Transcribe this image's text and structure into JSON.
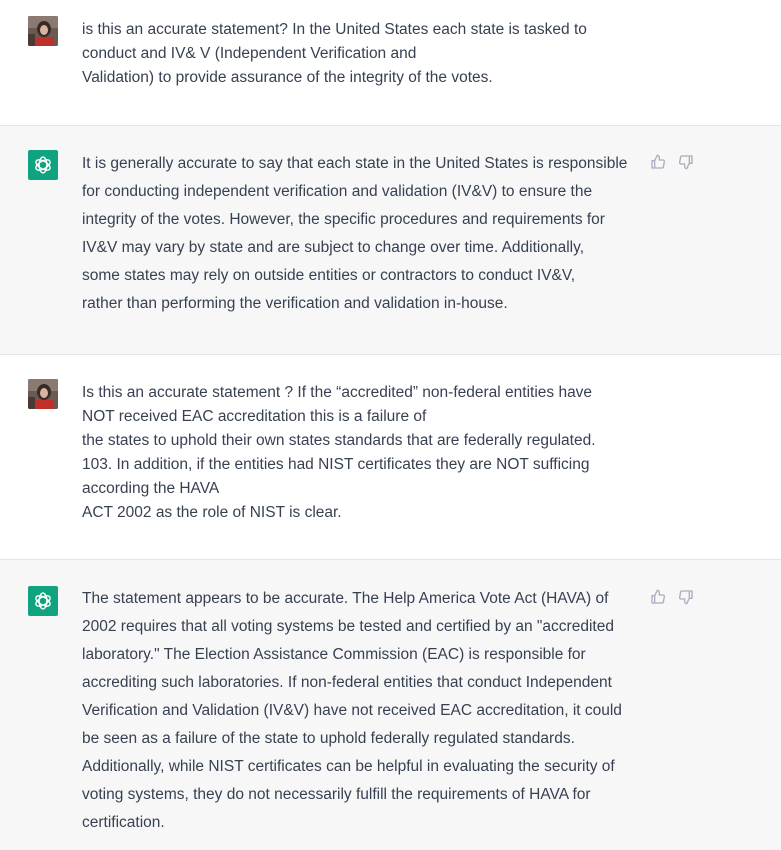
{
  "messages": [
    {
      "role": "user",
      "lines": [
        "is this an accurate statement? In the United States each state is tasked to",
        "conduct and IV& V (Independent Verification and",
        "Validation) to provide assurance of the integrity of the votes."
      ]
    },
    {
      "role": "assistant",
      "lines": [
        "It is generally accurate to say that each state in the United States is responsible",
        "for conducting independent verification and validation (IV&V) to ensure the",
        "integrity of the votes. However, the specific procedures and requirements for",
        "IV&V may vary by state and are subject to change over time. Additionally,",
        "some states may rely on outside entities or contractors to conduct IV&V,",
        "rather than performing the verification and validation in-house."
      ]
    },
    {
      "role": "user",
      "lines": [
        "Is this an accurate statement ? If the “accredited” non-federal entities have",
        "NOT received EAC accreditation this is a failure of",
        "the states to uphold their own states standards that are federally regulated.",
        "103. In addition, if the entities had NIST certificates they are NOT sufficing",
        "according the HAVA",
        "ACT 2002 as the role of NIST is clear."
      ]
    },
    {
      "role": "assistant",
      "lines": [
        "The statement appears to be accurate. The Help America Vote Act (HAVA) of",
        "2002 requires that all voting systems be tested and certified by an \"accredited",
        "laboratory.\" The Election Assistance Commission (EAC) is responsible for",
        "accrediting such laboratories. If non-federal entities that conduct Independent",
        "Verification and Validation (IV&V) have not received EAC accreditation, it could",
        "be seen as a failure of the state to uphold federally regulated standards.",
        "Additionally, while NIST certificates can be helpful in evaluating the security of",
        "voting systems, they do not necessarily fulfill the requirements of HAVA for",
        "certification."
      ]
    }
  ],
  "icons": {
    "user_avatar": "user-avatar-photo",
    "assistant_avatar": "openai-logo-icon",
    "thumbs_up": "thumbs-up-icon",
    "thumbs_down": "thumbs-down-icon"
  },
  "colors": {
    "assistant_bg": "#f7f7f8",
    "user_bg": "#ffffff",
    "brand_green": "#10a37f",
    "text": "#374151",
    "icon_gray": "#acacbe"
  }
}
